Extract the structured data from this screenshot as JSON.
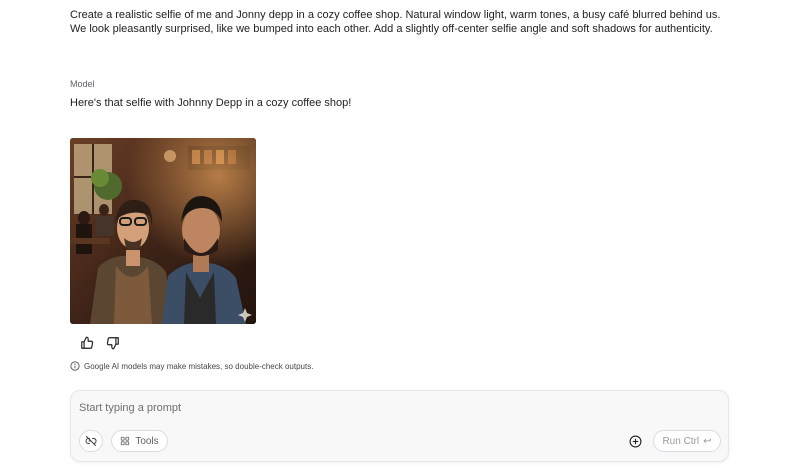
{
  "conversation": {
    "user_prompt": "Create a realistic selfie of me and  Jonny depp in a cozy coffee shop. Natural window light, warm tones, a busy café blurred behind us. We look pleasantly surprised, like we bumped into each other. Add a slightly off-center selfie angle and soft shadows for authenticity.",
    "model_label": "Model",
    "model_response": "Here's that selfie with Johnny Depp in a cozy coffee shop!"
  },
  "feedback": {
    "thumbs_up_icon": "thumbs-up-icon",
    "thumbs_down_icon": "thumbs-down-icon"
  },
  "disclaimer": {
    "icon": "info-icon",
    "text": "Google AI models may make mistakes, so double-check outputs."
  },
  "prompt_bar": {
    "placeholder": "Start typing a prompt",
    "value": "",
    "tools_label": "Tools",
    "run_label": "Run Ctrl",
    "run_shortcut_glyph": "↩"
  },
  "colors": {
    "prompt_bg": "#f8f8f8",
    "border": "#dadce0",
    "muted_text": "#5f6368"
  }
}
